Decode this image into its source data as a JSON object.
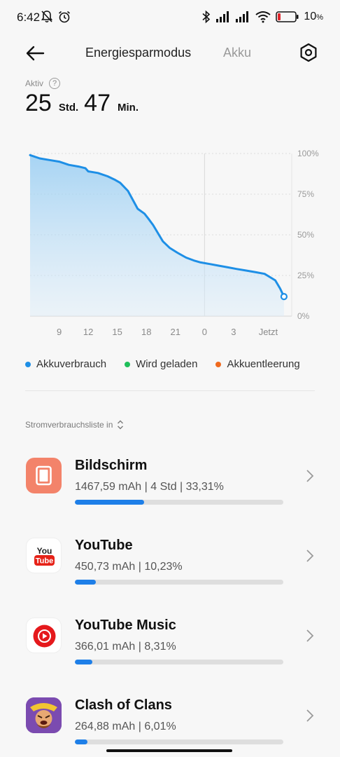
{
  "status_bar": {
    "time": "6:42",
    "battery_percent": "10"
  },
  "header": {
    "tab_active": "Energiesparmodus",
    "tab_inactive": "Akku"
  },
  "summary": {
    "active_label": "Aktiv",
    "help_glyph": "?",
    "hours": "25",
    "hours_unit": "Std.",
    "minutes": "47",
    "minutes_unit": "Min."
  },
  "chart_data": {
    "type": "area",
    "x_tick_labels": [
      "9",
      "12",
      "15",
      "18",
      "21",
      "0",
      "3",
      "Jetzt"
    ],
    "y_tick_labels": [
      "100%",
      "75%",
      "50%",
      "25%",
      "0%"
    ],
    "ylim": [
      0,
      100
    ],
    "series": [
      {
        "name": "Akkuverbrauch",
        "color": "#1e8fe6",
        "points": [
          [
            6,
            99
          ],
          [
            7,
            97
          ],
          [
            8,
            96
          ],
          [
            9,
            95
          ],
          [
            10,
            93
          ],
          [
            11,
            92
          ],
          [
            11.7,
            91
          ],
          [
            12,
            89
          ],
          [
            13,
            88
          ],
          [
            14,
            86
          ],
          [
            14.7,
            84
          ],
          [
            15.3,
            82
          ],
          [
            16.1,
            77
          ],
          [
            17.1,
            66
          ],
          [
            17.8,
            63
          ],
          [
            18.2,
            60
          ],
          [
            18.7,
            56
          ],
          [
            19.3,
            50
          ],
          [
            19.7,
            46
          ],
          [
            20.4,
            42
          ],
          [
            21.2,
            39
          ],
          [
            22.1,
            36
          ],
          [
            23,
            34
          ],
          [
            23.6,
            33
          ],
          [
            24.6,
            32
          ],
          [
            25.5,
            31
          ],
          [
            26.4,
            30
          ],
          [
            27.3,
            29
          ],
          [
            28.3,
            28
          ],
          [
            29.3,
            27
          ],
          [
            30.2,
            26
          ],
          [
            31.3,
            22
          ],
          [
            31.8,
            17
          ],
          [
            32.2,
            12
          ]
        ]
      }
    ],
    "grid": true
  },
  "legend": [
    {
      "label": "Akkuverbrauch",
      "color": "#1e8fe6"
    },
    {
      "label": "Wird geladen",
      "color": "#1fbf5a"
    },
    {
      "label": "Akkuentleerung",
      "color": "#f06a1e"
    }
  ],
  "sort": {
    "label": "Stromverbrauchsliste in"
  },
  "apps": [
    {
      "name": "Bildschirm",
      "detail": "1467,59 mAh | 4 Std  | 33,31%",
      "share": 0.3331,
      "icon": "phone-screen-icon"
    },
    {
      "name": "YouTube",
      "detail": "450,73 mAh | 10,23%",
      "share": 0.1023,
      "icon": "youtube-icon"
    },
    {
      "name": "YouTube Music",
      "detail": "366,01 mAh | 8,31%",
      "share": 0.0831,
      "icon": "youtube-music-icon"
    },
    {
      "name": "Clash of Clans",
      "detail": "264,88 mAh | 6,01%",
      "share": 0.0601,
      "icon": "clash-of-clans-icon"
    }
  ]
}
